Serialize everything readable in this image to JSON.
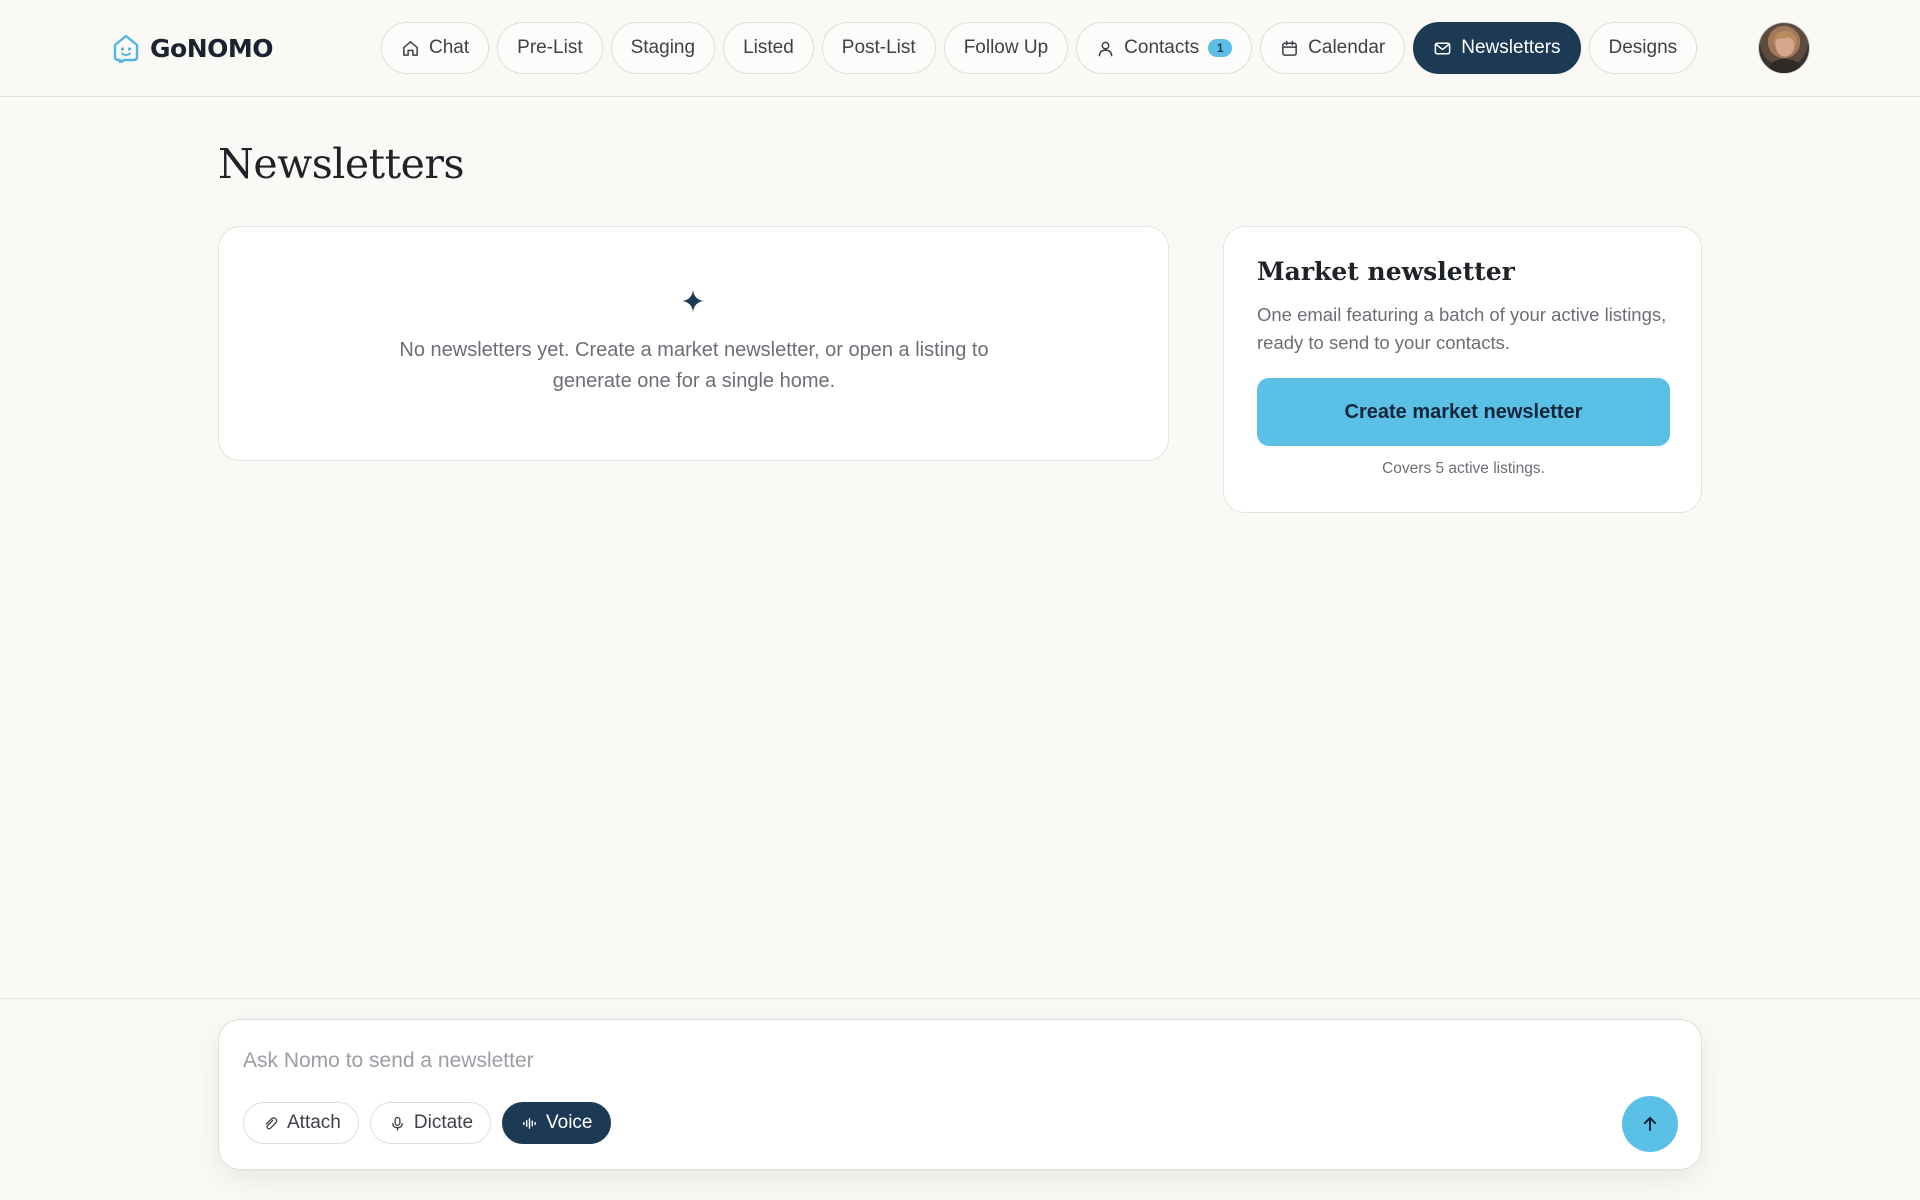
{
  "brand": {
    "name": "GoNOMO",
    "icon": "house-face-logo-icon"
  },
  "nav": {
    "items": [
      {
        "label": "Chat",
        "icon": "home-icon"
      },
      {
        "label": "Pre-List"
      },
      {
        "label": "Staging"
      },
      {
        "label": "Listed"
      },
      {
        "label": "Post-List"
      },
      {
        "label": "Follow Up"
      },
      {
        "label": "Contacts",
        "icon": "person-icon",
        "badge": "1"
      },
      {
        "label": "Calendar",
        "icon": "calendar-icon"
      },
      {
        "label": "Newsletters",
        "icon": "mail-icon",
        "active": true
      },
      {
        "label": "Designs"
      }
    ]
  },
  "page": {
    "title": "Newsletters"
  },
  "empty_state": {
    "icon": "sparkle-icon",
    "message": "No newsletters yet. Create a market newsletter, or open a listing to generate one for a single home."
  },
  "market": {
    "title": "Market newsletter",
    "description": "One email featuring a batch of your active listings, ready to send to your contacts.",
    "cta_label": "Create market newsletter",
    "note": "Covers 5 active listings."
  },
  "composer": {
    "placeholder": "Ask Nomo to send a newsletter",
    "value": "",
    "attach_label": "Attach",
    "dictate_label": "Dictate",
    "voice_label": "Voice"
  },
  "colors": {
    "accent": "#5bc0e6",
    "navy": "#1d3a55",
    "background": "#faf9f6"
  }
}
